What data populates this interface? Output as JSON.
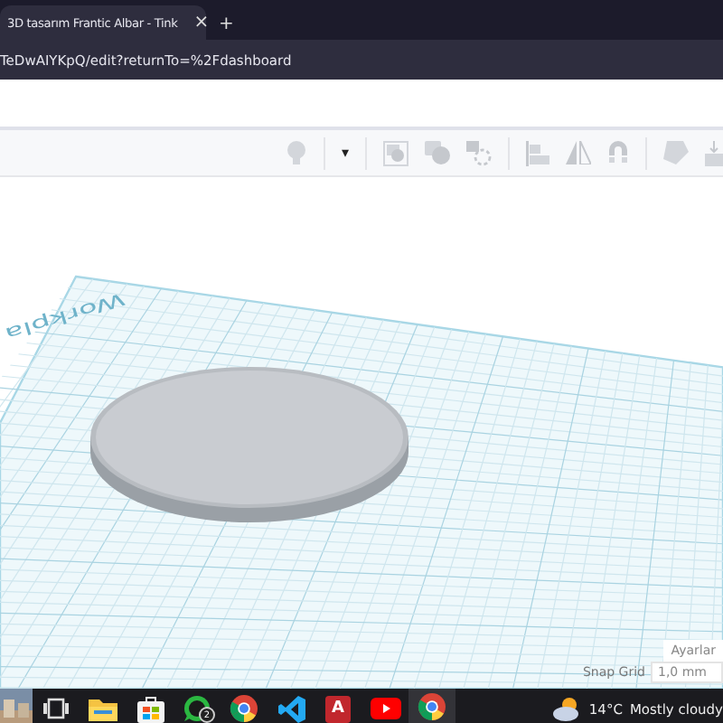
{
  "browser": {
    "tab": {
      "title": "3D tasarım Frantic Albar - Tink",
      "close": "×",
      "selected": true
    },
    "new_tab": "+",
    "address": "TeDwAIYKpQ/edit?returnTo=%2Fdashboard"
  },
  "toolbar": {
    "caret": "▾"
  },
  "canvas": {
    "workplane_label": "Workpla",
    "settings_button": "Ayarlar",
    "snap_grid": {
      "label": "Snap Grid",
      "value": "1,0 mm"
    }
  },
  "taskbar": {
    "apps": [
      {
        "kind": "taskview",
        "selected": false
      },
      {
        "kind": "explorer",
        "selected": false
      },
      {
        "kind": "store",
        "selected": false
      },
      {
        "kind": "whatsapp",
        "selected": false,
        "badge": "2"
      },
      {
        "kind": "chrome",
        "selected": false
      },
      {
        "kind": "vscode",
        "selected": false
      },
      {
        "kind": "access",
        "selected": false,
        "letter": "A"
      },
      {
        "kind": "youtube",
        "selected": false
      },
      {
        "kind": "chrome",
        "selected": true
      }
    ],
    "weather": {
      "temperature": "14°C",
      "condition": "Mostly cloudy"
    }
  }
}
